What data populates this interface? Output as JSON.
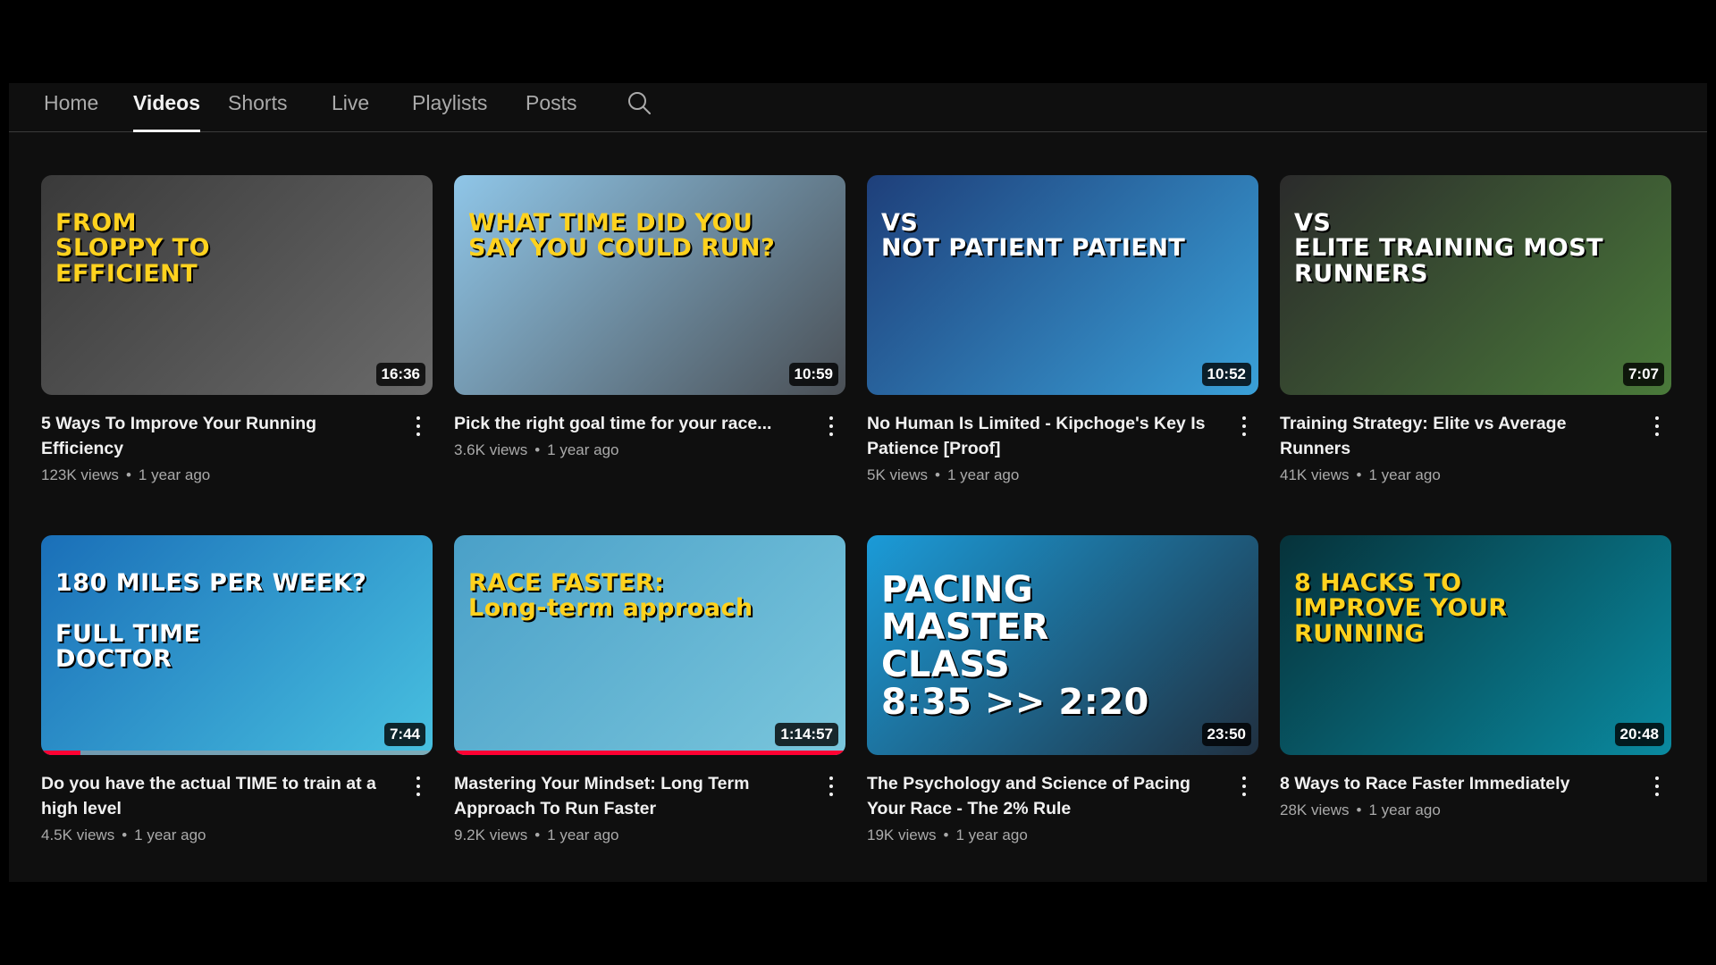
{
  "tabs": [
    {
      "label": "Home"
    },
    {
      "label": "Videos",
      "active": true
    },
    {
      "label": "Shorts"
    },
    {
      "label": "Live"
    },
    {
      "label": "Playlists"
    },
    {
      "label": "Posts"
    }
  ],
  "search_icon": "search-icon",
  "more_icon": "more-vertical-icon",
  "videos": [
    {
      "title": "5 Ways To Improve Your Running Efficiency",
      "views": "123K views",
      "age": "1 year ago",
      "duration": "16:36",
      "thumb_text": "FROM\nSLOPPY   TO\n          EFFICIENT",
      "thumb_colors": [
        "#3a3a3a",
        "#6a6a6a"
      ],
      "text_color": "#ffd21e"
    },
    {
      "title": "Pick the right goal time for your race...",
      "views": "3.6K views",
      "age": "1 year ago",
      "duration": "10:59",
      "thumb_text": "WHAT TIME DID YOU\nSAY YOU COULD RUN?",
      "thumb_colors": [
        "#8fc6e8",
        "#4a4f55"
      ],
      "text_color": "#ffd21e"
    },
    {
      "title": "No Human Is Limited - Kipchoge's Key Is Patience [Proof]",
      "views": "5K views",
      "age": "1 year ago",
      "duration": "10:52",
      "thumb_text": "VS\nNOT PATIENT    PATIENT",
      "thumb_colors": [
        "#1e3f7a",
        "#3aa0d8"
      ],
      "text_color": "#ffffff"
    },
    {
      "title": "Training Strategy: Elite vs Average Runners",
      "views": "41K views",
      "age": "1 year ago",
      "duration": "7:07",
      "thumb_text": "VS\nELITE TRAINING   MOST RUNNERS",
      "thumb_colors": [
        "#2b2b2b",
        "#4a7a3a"
      ],
      "text_color": "#ffffff"
    },
    {
      "title": "Do you have the actual TIME to train at a high level",
      "views": "4.5K views",
      "age": "1 year ago",
      "duration": "7:44",
      "progress": 0.1,
      "thumb_text": "180 MILES PER WEEK?\n\n        FULL TIME\n        DOCTOR",
      "thumb_colors": [
        "#1a6fb8",
        "#48c0e0"
      ],
      "text_color": "#ffffff"
    },
    {
      "title": "Mastering Your Mindset: Long Term Approach To Run Faster",
      "views": "9.2K views",
      "age": "1 year ago",
      "duration": "1:14:57",
      "progress": 1.0,
      "thumb_text": "RACE FASTER:\nLong-term approach",
      "thumb_colors": [
        "#4aa0c8",
        "#7ac6dc"
      ],
      "text_color": "#ffd21e"
    },
    {
      "title": "The Psychology and Science of Pacing Your Race - The 2% Rule",
      "views": "19K views",
      "age": "1 year ago",
      "duration": "23:50",
      "thumb_text": "PACING\nMASTER\nCLASS\n8:35 >> 2:20",
      "thumb_colors": [
        "#1b9bd8",
        "#203040"
      ],
      "text_color": "#ffffff"
    },
    {
      "title": "8 Ways to Race Faster Immediately",
      "views": "28K views",
      "age": "1 year ago",
      "duration": "20:48",
      "thumb_text": "8 HACKS TO\nIMPROVE YOUR\nRUNNING",
      "thumb_colors": [
        "#06323a",
        "#0a8aa0"
      ],
      "text_color": "#ffd21e"
    }
  ]
}
